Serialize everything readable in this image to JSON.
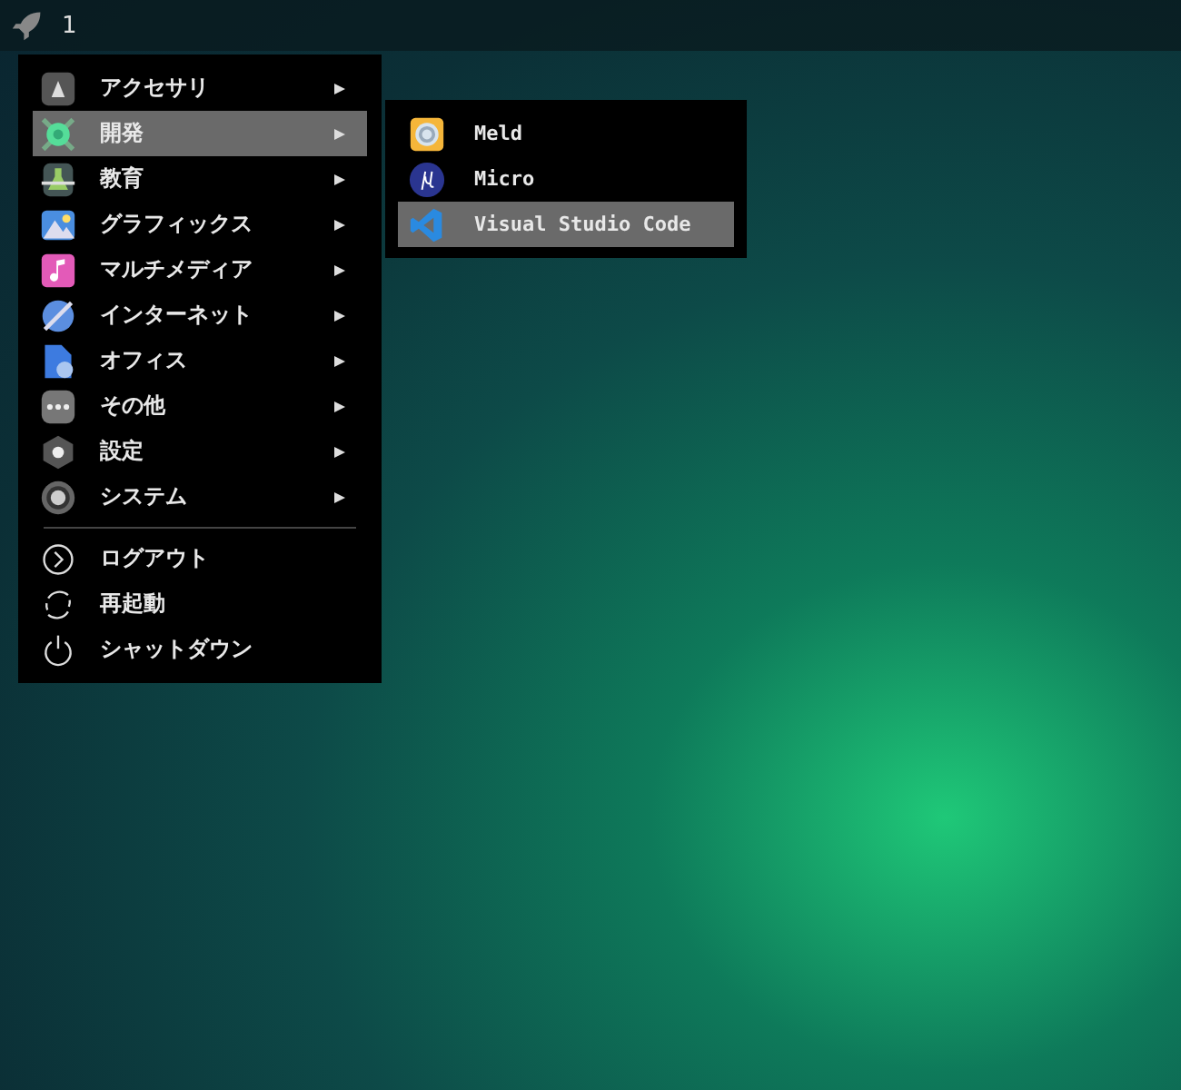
{
  "panel": {
    "workspace": "1"
  },
  "menu": {
    "items": [
      {
        "label": "アクセサリ",
        "selected": false,
        "has_submenu": true
      },
      {
        "label": "開発",
        "selected": true,
        "has_submenu": true
      },
      {
        "label": "教育",
        "selected": false,
        "has_submenu": true
      },
      {
        "label": "グラフィックス",
        "selected": false,
        "has_submenu": true
      },
      {
        "label": "マルチメディア",
        "selected": false,
        "has_submenu": true
      },
      {
        "label": "インターネット",
        "selected": false,
        "has_submenu": true
      },
      {
        "label": "オフィス",
        "selected": false,
        "has_submenu": true
      },
      {
        "label": "その他",
        "selected": false,
        "has_submenu": true
      },
      {
        "label": "設定",
        "selected": false,
        "has_submenu": true
      },
      {
        "label": "システム",
        "selected": false,
        "has_submenu": true
      }
    ],
    "actions": [
      {
        "label": "ログアウト"
      },
      {
        "label": "再起動"
      },
      {
        "label": "シャットダウン"
      }
    ]
  },
  "submenu": {
    "items": [
      {
        "label": "Meld",
        "selected": false
      },
      {
        "label": "Micro",
        "selected": false
      },
      {
        "label": "Visual Studio Code",
        "selected": true
      }
    ]
  }
}
